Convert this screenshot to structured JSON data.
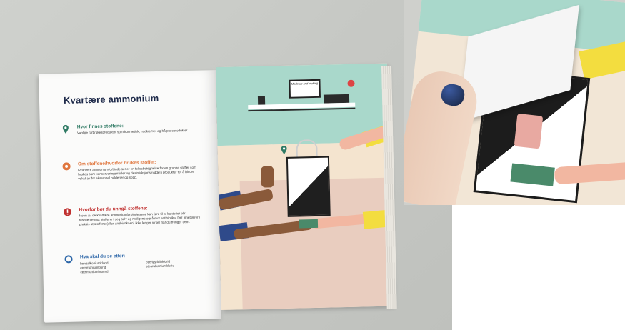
{
  "booklet": {
    "title": "Kvartære ammonium",
    "sections": [
      {
        "icon": "location-pin-icon",
        "color": "#2f7a64",
        "heading": "Hvor finnes stoffene:",
        "body": "Vanlige forbrukesprodukter som kosmetikk, hudkremer og hårpleieprodukter"
      },
      {
        "icon": "gear-icon",
        "color": "#e0773f",
        "heading": "Om stoffene/hvorfor brukes stoffet:",
        "body": "Kvartære ammoniumforbindelser er en fellesbetegnelse for en gruppe stoffer som brukes som konserveringsmidler og desinfeksjonsmiddel i produkter for å hindre vekst av for eksempel bakterier og sopp."
      },
      {
        "icon": "exclamation-icon",
        "color": "#c0302f",
        "heading": "Hvorfor bør du unngå stoffene:",
        "body": "Noen av de kvartære ammoniumforbindelsene kan føre til at bakterier blir resistente mot stoffene i seg selv og muligens også mot antibiotika. Det innebærer i praksis at stoffene (eller antibiotikaen) ikke lenger virker når du trenger dem."
      },
      {
        "icon": "ring-icon",
        "color": "#2c66a8",
        "heading": "Hva skal du se etter:",
        "list": [
          "benzalkoniumklorid",
          "cetylpyridinklorid",
          "cetrimoniumklorid",
          "stearalkoniumklorid",
          "cetrimoniumbromid"
        ]
      }
    ],
    "frame_text": "Made up and making"
  },
  "colors": {
    "wall": "#a9d8cb",
    "floor": "#f4e4cf",
    "yellow": "#f3dd3f"
  }
}
